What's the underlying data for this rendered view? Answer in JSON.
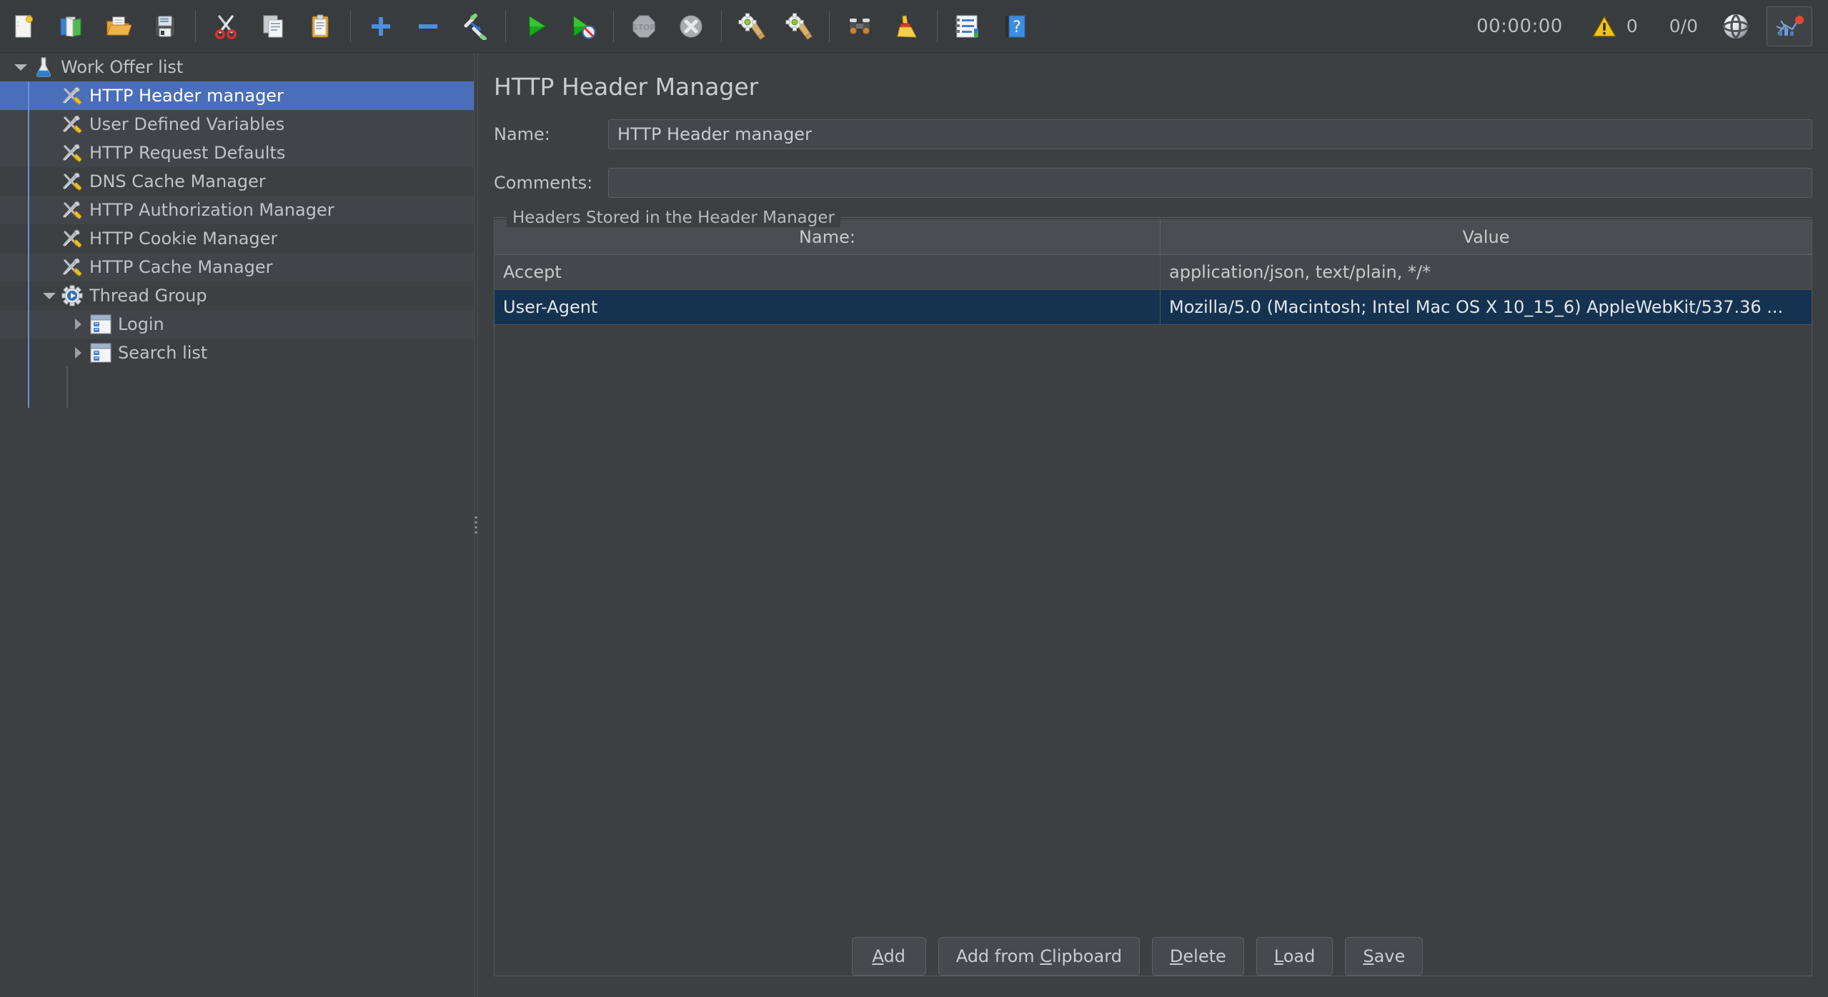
{
  "app": {
    "title": "Apache JMeter"
  },
  "toolbar": {
    "buttons": [
      {
        "name": "new-button",
        "icon": "new-document-icon",
        "label": "New"
      },
      {
        "name": "templates-button",
        "icon": "templates-icon",
        "label": "Templates"
      },
      {
        "name": "open-button",
        "icon": "open-folder-icon",
        "label": "Open"
      },
      {
        "name": "save-button",
        "icon": "save-floppy-icon",
        "label": "Save"
      },
      {
        "name": "cut-button",
        "icon": "scissors-icon",
        "label": "Cut"
      },
      {
        "name": "copy-button",
        "icon": "copy-pages-icon",
        "label": "Copy"
      },
      {
        "name": "paste-button",
        "icon": "clipboard-icon",
        "label": "Paste"
      },
      {
        "name": "expand-all-button",
        "icon": "plus-icon",
        "label": "Expand All"
      },
      {
        "name": "collapse-all-button",
        "icon": "minus-icon",
        "label": "Collapse All"
      },
      {
        "name": "toggle-button",
        "icon": "toggle-pencil-icon",
        "label": "Toggle"
      },
      {
        "name": "start-button",
        "icon": "green-play-icon",
        "label": "Start"
      },
      {
        "name": "start-no-timers-button",
        "icon": "green-play-no-timers-icon",
        "label": "Start no pauses"
      },
      {
        "name": "stop-button",
        "icon": "stop-sign-icon",
        "label": "Stop"
      },
      {
        "name": "shutdown-button",
        "icon": "shutdown-x-icon",
        "label": "Shutdown"
      },
      {
        "name": "clear-button",
        "icon": "gear-broom-icon",
        "label": "Clear"
      },
      {
        "name": "clear-all-button",
        "icon": "gear-broom-all-icon",
        "label": "Clear All"
      },
      {
        "name": "search-button",
        "icon": "binoculars-icon",
        "label": "Search"
      },
      {
        "name": "reset-search-button",
        "icon": "yellow-broom-icon",
        "label": "Reset Search"
      },
      {
        "name": "function-helper-button",
        "icon": "log-list-icon",
        "label": "Function Helper Dialog"
      },
      {
        "name": "help-button",
        "icon": "help-book-icon",
        "label": "Help"
      }
    ],
    "separators_after": [
      3,
      6,
      9,
      11,
      13,
      15,
      17
    ],
    "status": {
      "elapsed_time": "00:00:00",
      "warning_count": "0",
      "thread_count": "0/0",
      "sphere_icon": "sphere-icon",
      "last_icon": "jmeter-logo-icon"
    }
  },
  "tree": {
    "items": [
      {
        "label": "Work Offer list",
        "icon": "test-plan-icon",
        "depth": 0,
        "twisty": "down",
        "selected": false,
        "striped": false
      },
      {
        "label": "HTTP Header manager",
        "icon": "config-element-icon",
        "depth": 1,
        "twisty": "none",
        "selected": true,
        "striped": false
      },
      {
        "label": "User Defined Variables",
        "icon": "config-element-icon",
        "depth": 1,
        "twisty": "none",
        "selected": false,
        "striped": true
      },
      {
        "label": "HTTP Request Defaults",
        "icon": "config-element-icon",
        "depth": 1,
        "twisty": "none",
        "selected": false,
        "striped": true
      },
      {
        "label": "DNS Cache Manager",
        "icon": "config-element-icon",
        "depth": 1,
        "twisty": "none",
        "selected": false,
        "striped": false
      },
      {
        "label": "HTTP Authorization Manager",
        "icon": "config-element-icon",
        "depth": 1,
        "twisty": "none",
        "selected": false,
        "striped": true
      },
      {
        "label": "HTTP Cookie Manager",
        "icon": "config-element-icon",
        "depth": 1,
        "twisty": "none",
        "selected": false,
        "striped": false
      },
      {
        "label": "HTTP Cache Manager",
        "icon": "config-element-icon",
        "depth": 1,
        "twisty": "none",
        "selected": false,
        "striped": true
      },
      {
        "label": "Thread Group",
        "icon": "thread-group-icon",
        "depth": 1,
        "twisty": "down",
        "selected": false,
        "striped": false
      },
      {
        "label": "Login",
        "icon": "transaction-controller-icon",
        "depth": 2,
        "twisty": "right",
        "selected": false,
        "striped": true
      },
      {
        "label": "Search list",
        "icon": "transaction-controller-icon",
        "depth": 2,
        "twisty": "right",
        "selected": false,
        "striped": false
      }
    ]
  },
  "panel": {
    "title": "HTTP Header Manager",
    "name_label": "Name:",
    "name_value": "HTTP Header manager",
    "comments_label": "Comments:",
    "comments_value": "",
    "comments_placeholder": "",
    "group_title": "Headers Stored in the Header Manager",
    "table": {
      "columns": [
        "Name:",
        "Value"
      ],
      "rows": [
        {
          "name": "Accept",
          "value": "application/json, text/plain, */*",
          "selected": false
        },
        {
          "name": "User-Agent",
          "value": "Mozilla/5.0 (Macintosh; Intel Mac OS X 10_15_6) AppleWebKit/537.36 ...",
          "selected": true
        }
      ]
    },
    "buttons": [
      {
        "name": "add-button",
        "pre": "",
        "mn": "A",
        "post": "dd"
      },
      {
        "name": "add-from-clipboard-button",
        "pre": "Add from ",
        "mn": "C",
        "post": "lipboard"
      },
      {
        "name": "delete-button",
        "pre": "",
        "mn": "D",
        "post": "elete"
      },
      {
        "name": "load-button",
        "pre": "",
        "mn": "L",
        "post": "oad"
      },
      {
        "name": "save-button",
        "pre": "",
        "mn": "S",
        "post": "ave"
      }
    ]
  },
  "colors": {
    "background": "#3c4043",
    "panel_alt": "#41454a",
    "tree_selection": "#4a6eb8",
    "table_selection": "#153351",
    "text": "#c6cacd",
    "accent_blue": "#4a8fe0",
    "warn_yellow": "#f2c317",
    "green_play": "#1fa01f"
  }
}
